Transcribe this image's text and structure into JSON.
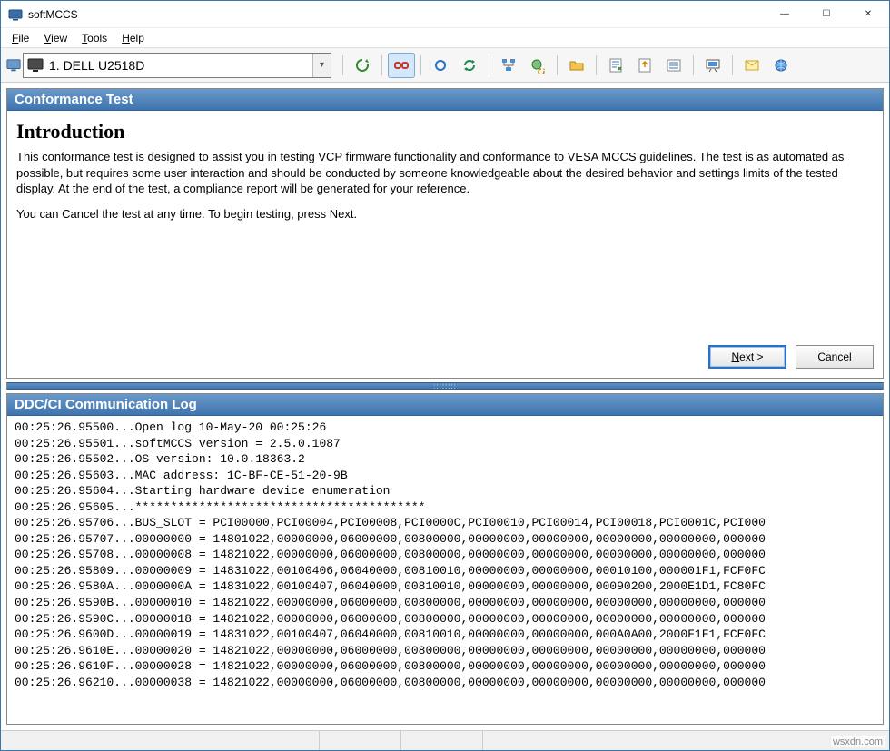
{
  "window": {
    "title": "softMCCS",
    "controls": {
      "minimize": "—",
      "maximize": "☐",
      "close": "✕"
    }
  },
  "menu": {
    "file": "File",
    "view": "View",
    "tools": "Tools",
    "help": "Help"
  },
  "toolbar": {
    "display_selected": "1. DELL U2518D",
    "icons": {
      "refresh": "refresh-icon",
      "link": "link-icon",
      "rotate": "rotate-icon",
      "cycle": "cycle-icon",
      "tree": "tree-icon",
      "globe_refresh": "globe-refresh-icon",
      "folder": "folder-open-icon",
      "save_doc": "save-doc-icon",
      "export": "export-icon",
      "list": "list-icon",
      "presentation": "presentation-icon",
      "mail": "mail-icon",
      "web": "web-icon"
    }
  },
  "conformance": {
    "header": "Conformance Test",
    "intro_title": "Introduction",
    "intro_p1": "This conformance test is designed to assist you in testing VCP firmware functionality and conformance to VESA MCCS guidelines. The test is as automated as possible, but requires some user interaction and should be conducted by someone knowledgeable about the desired behavior and settings limits of the tested display. At the end of the test, a compliance report will be generated for your reference.",
    "intro_p2": "You can Cancel the test at any time. To begin testing, press Next.",
    "next_label": "Next >",
    "cancel_label": "Cancel"
  },
  "log": {
    "header": "DDC/CI Communication Log",
    "lines": [
      "00:25:26.95500...Open log 10-May-20 00:25:26",
      "00:25:26.95501...softMCCS version = 2.5.0.1087",
      "00:25:26.95502...OS version: 10.0.18363.2",
      "00:25:26.95603...MAC address: 1C-BF-CE-51-20-9B",
      "00:25:26.95604...Starting hardware device enumeration",
      "00:25:26.95605...*****************************************",
      "00:25:26.95706...BUS_SLOT = PCI00000,PCI00004,PCI00008,PCI0000C,PCI00010,PCI00014,PCI00018,PCI0001C,PCI000",
      "00:25:26.95707...00000000 = 14801022,00000000,06000000,00800000,00000000,00000000,00000000,00000000,000000",
      "00:25:26.95708...00000008 = 14821022,00000000,06000000,00800000,00000000,00000000,00000000,00000000,000000",
      "00:25:26.95809...00000009 = 14831022,00100406,06040000,00810010,00000000,00000000,00010100,000001F1,FCF0FC",
      "00:25:26.9580A...0000000A = 14831022,00100407,06040000,00810010,00000000,00000000,00090200,2000E1D1,FC80FC",
      "00:25:26.9590B...00000010 = 14821022,00000000,06000000,00800000,00000000,00000000,00000000,00000000,000000",
      "00:25:26.9590C...00000018 = 14821022,00000000,06000000,00800000,00000000,00000000,00000000,00000000,000000",
      "00:25:26.9600D...00000019 = 14831022,00100407,06040000,00810010,00000000,00000000,000A0A00,2000F1F1,FCE0FC",
      "00:25:26.9610E...00000020 = 14821022,00000000,06000000,00800000,00000000,00000000,00000000,00000000,000000",
      "00:25:26.9610F...00000028 = 14821022,00000000,06000000,00800000,00000000,00000000,00000000,00000000,000000",
      "00:25:26.96210...00000038 = 14821022,00000000,06000000,00800000,00000000,00000000,00000000,00000000,000000"
    ]
  },
  "watermark": "wsxdn.com"
}
